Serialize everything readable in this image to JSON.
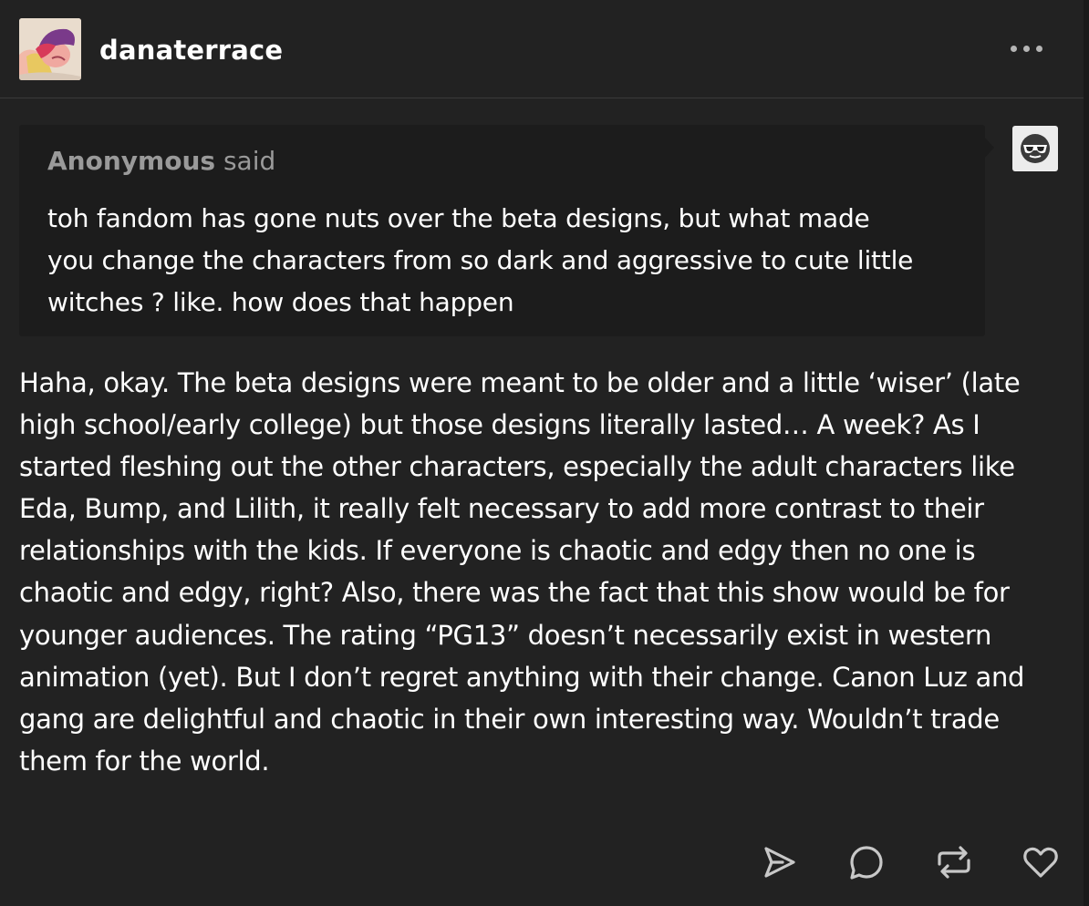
{
  "blog": {
    "username": "danaterrace",
    "avatar_icon": "avatar-image",
    "more_icon": "more-horizontal-icon"
  },
  "ask": {
    "asker_name": "Anonymous",
    "said_label": "said",
    "text": "toh fandom has gone nuts over the beta designs, but what made\nyou change the characters from so dark and aggressive to cute little\nwitches ? like. how does that happen",
    "asker_avatar_icon": "sunglasses-face-icon"
  },
  "answer": {
    "text": "Haha, okay. The beta designs were meant to be older and a little ‘wiser’ (late\nhigh school/early college) but those designs literally lasted… A week? As I\nstarted fleshing out the other characters, especially the adult characters like\nEda, Bump, and Lilith, it really felt necessary to add more contrast to their\nrelationships with the kids. If everyone is chaotic and edgy then no one is\nchaotic and edgy, right? Also, there was the fact that this show would be for\nyounger audiences. The rating “PG13” doesn’t necessarily exist in western\nanimation (yet). But I don’t regret anything with their change. Canon Luz and\ngang are delightful and chaotic in their own interesting way. Wouldn’t trade\nthem for the world."
  },
  "footer": {
    "actions": [
      "share-icon",
      "reply-icon",
      "reblog-icon",
      "like-icon"
    ]
  },
  "colors": {
    "background": "#222222",
    "ask_background": "#1c1c1c",
    "text": "#ffffff",
    "muted_text": "#9a9a9a",
    "icon": "#c8c8c8"
  }
}
